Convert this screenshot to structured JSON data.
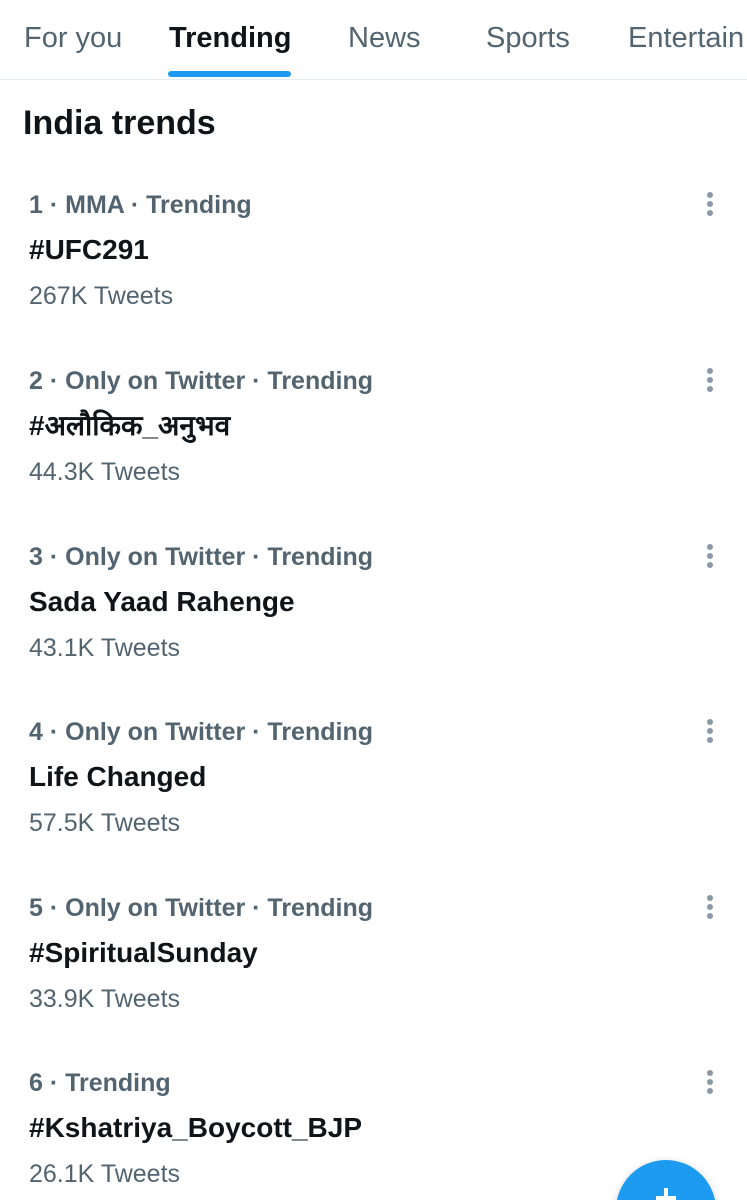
{
  "tabs": [
    {
      "label": "For you",
      "active": false
    },
    {
      "label": "Trending",
      "active": true
    },
    {
      "label": "News",
      "active": false
    },
    {
      "label": "Sports",
      "active": false
    },
    {
      "label": "Entertain",
      "active": false
    }
  ],
  "section_title": "India trends",
  "trends": [
    {
      "meta": "1 · MMA · Trending",
      "name": "#UFC291",
      "count": "267K Tweets"
    },
    {
      "meta": "2 · Only on Twitter · Trending",
      "name": "#अलौकिक_अनुभव",
      "count": "44.3K Tweets"
    },
    {
      "meta": "3 · Only on Twitter · Trending",
      "name": "Sada Yaad Rahenge",
      "count": "43.1K Tweets"
    },
    {
      "meta": "4 · Only on Twitter · Trending",
      "name": "Life Changed",
      "count": "57.5K Tweets"
    },
    {
      "meta": "5 · Only on Twitter · Trending",
      "name": "#SpiritualSunday",
      "count": "33.9K Tweets"
    },
    {
      "meta": "6 · Trending",
      "name": "#Kshatriya_Boycott_BJP",
      "count": "26.1K Tweets"
    }
  ],
  "icons": {
    "more": "more-vertical-icon",
    "compose": "plus-icon"
  },
  "colors": {
    "accent": "#1d9bf0",
    "secondary_text": "#536471",
    "primary_text": "#0f1419"
  }
}
